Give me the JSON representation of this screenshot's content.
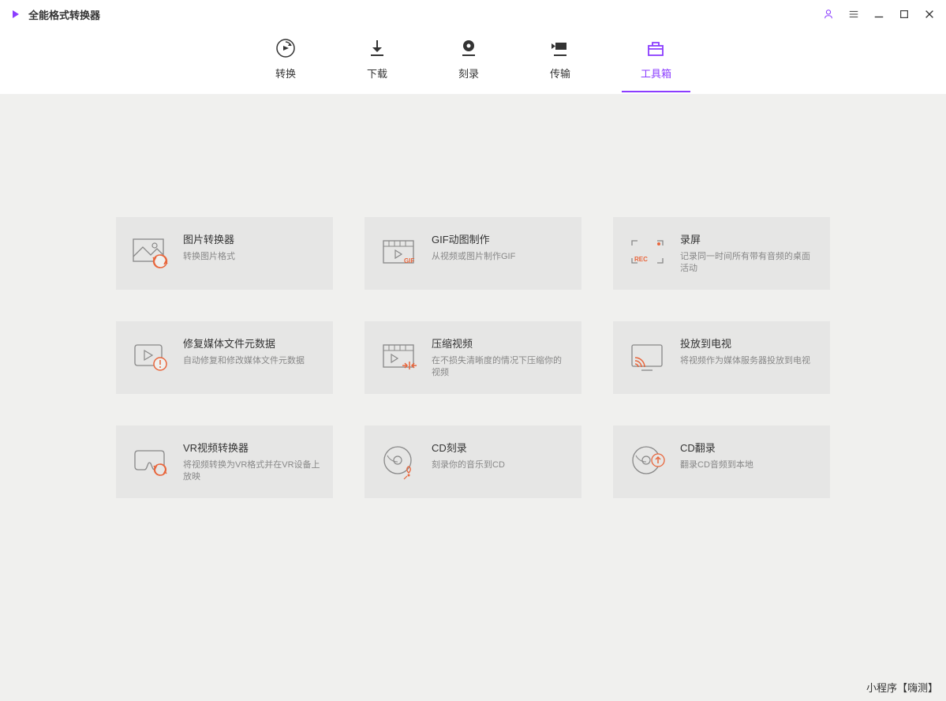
{
  "app": {
    "title": "全能格式转换器"
  },
  "nav": {
    "tabs": [
      {
        "label": "转换"
      },
      {
        "label": "下载"
      },
      {
        "label": "刻录"
      },
      {
        "label": "传输"
      },
      {
        "label": "工具箱"
      }
    ]
  },
  "tools": [
    {
      "title": "图片转换器",
      "desc": "转换图片格式"
    },
    {
      "title": "GIF动图制作",
      "desc": "从视频或图片制作GIF"
    },
    {
      "title": "录屏",
      "desc": "记录同一时间所有带有音频的桌面活动"
    },
    {
      "title": "修复媒体文件元数据",
      "desc": "自动修复和修改媒体文件元数据"
    },
    {
      "title": "压缩视频",
      "desc": "在不损失清晰度的情况下压缩你的视频"
    },
    {
      "title": "投放到电视",
      "desc": "将视频作为媒体服务器投放到电视"
    },
    {
      "title": "VR视频转换器",
      "desc": "将视频转换为VR格式并在VR设备上放映"
    },
    {
      "title": "CD刻录",
      "desc": "刻录你的音乐到CD"
    },
    {
      "title": "CD翻录",
      "desc": "翻录CD音频到本地"
    }
  ],
  "watermark": "小程序【嗨测】"
}
